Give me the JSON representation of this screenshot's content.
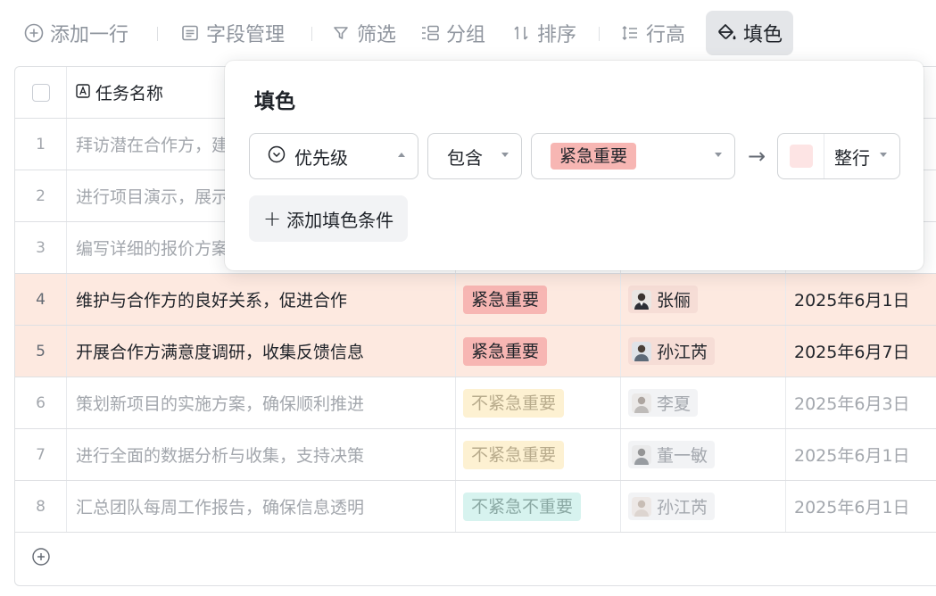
{
  "toolbar": {
    "add_row": "添加一行",
    "field_manage": "字段管理",
    "filter": "筛选",
    "group": "分组",
    "sort": "排序",
    "row_height": "行高",
    "fill_color": "填色"
  },
  "table": {
    "header": {
      "task_name": "任务名称"
    },
    "rows": [
      {
        "index": "1",
        "task": "拜访潜在合作方，建",
        "priority": "",
        "owner": "",
        "date": "",
        "state": "dim"
      },
      {
        "index": "2",
        "task": "进行项目演示，展示",
        "priority": "",
        "owner": "",
        "date": "",
        "state": "dim"
      },
      {
        "index": "3",
        "task": "编写详细的报价方案",
        "priority": "",
        "owner": "",
        "date": "",
        "state": "dim"
      },
      {
        "index": "4",
        "task": "维护与合作方的良好关系，促进合作",
        "priority": "紧急重要",
        "owner": "张俪",
        "date": "2025年6月1日",
        "state": "hl"
      },
      {
        "index": "5",
        "task": "开展合作方满意度调研，收集反馈信息",
        "priority": "紧急重要",
        "owner": "孙江芮",
        "date": "2025年6月7日",
        "state": "hl"
      },
      {
        "index": "6",
        "task": "策划新项目的实施方案，确保顺利推进",
        "priority": "不紧急重要",
        "owner": "李夏",
        "date": "2025年6月3日",
        "state": "dim"
      },
      {
        "index": "7",
        "task": "进行全面的数据分析与收集，支持决策",
        "priority": "不紧急重要",
        "owner": "董一敏",
        "date": "2025年6月1日",
        "state": "dim"
      },
      {
        "index": "8",
        "task": "汇总团队每周工作报告，确保信息透明",
        "priority": "不紧急不重要",
        "owner": "孙江芮",
        "date": "2025年6月1日",
        "state": "dim"
      }
    ]
  },
  "fill_panel": {
    "title": "填色",
    "field": "优先级",
    "operator": "包含",
    "value_tag": "紧急重要",
    "arrow": "→",
    "scope": "整行",
    "add_condition": "添加填色条件",
    "add_condition_icon": "+"
  },
  "colors": {
    "highlight_row": "#fde9e0",
    "swatch": "#fde4e4",
    "tag_urgent_important": "#f7b6b3",
    "tag_not_urgent_important": "#fdf1d2",
    "tag_not_urgent_not_important": "#d7f3ef"
  }
}
